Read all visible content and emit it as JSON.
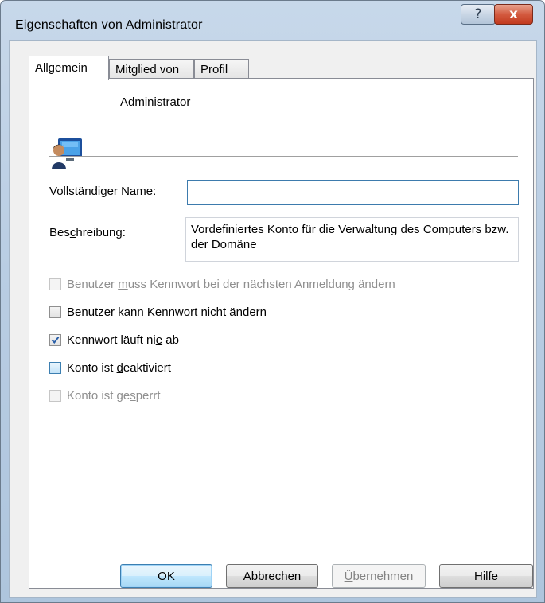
{
  "window": {
    "title": "Eigenschaften von Administrator",
    "help_glyph": "?",
    "close_glyph": "x"
  },
  "tabs": [
    {
      "label": "Allgemein",
      "active": true
    },
    {
      "label": "Mitglied von",
      "active": false
    },
    {
      "label": "Profil",
      "active": false
    }
  ],
  "general": {
    "icon": "user-computer-icon",
    "account_name": "Administrator",
    "full_name": {
      "label_prefix": "",
      "label_mnemonic": "V",
      "label_rest": "ollständiger Name:",
      "value": ""
    },
    "description": {
      "label_prefix": "Bes",
      "label_mnemonic": "c",
      "label_rest": "hreibung:",
      "value": "Vordefiniertes Konto für die Verwaltung des Computers bzw. der Domäne"
    }
  },
  "options": [
    {
      "pre": "Benutzer ",
      "mn": "m",
      "post": "uss Kennwort bei der nächsten Anmeldung ändern",
      "checked": false,
      "enabled": false
    },
    {
      "pre": "Benutzer kann Kennwort ",
      "mn": "n",
      "post": "icht ändern",
      "checked": false,
      "enabled": true
    },
    {
      "pre": "Kennwort läuft ni",
      "mn": "e",
      "post": " ab",
      "checked": true,
      "enabled": true
    },
    {
      "pre": "Konto ist ",
      "mn": "d",
      "post": "eaktiviert",
      "checked": false,
      "enabled": true
    },
    {
      "pre": "Konto ist ge",
      "mn": "s",
      "post": "perrt",
      "checked": false,
      "enabled": false
    }
  ],
  "buttons": {
    "ok": "OK",
    "cancel": "Abbrechen",
    "apply_mnemonic": "Ü",
    "apply_rest": "bernehmen",
    "help": "Hilfe"
  },
  "colors": {
    "accent": "#3c7fb1",
    "close_button": "#c23a1f",
    "disabled_text": "#8f8f8f"
  }
}
